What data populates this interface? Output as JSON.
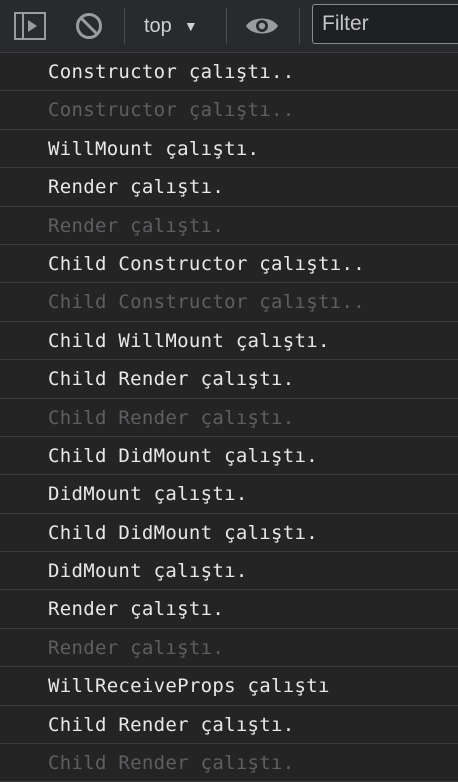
{
  "toolbar": {
    "sidebar_toggle_icon": "sidebar-toggle-icon",
    "clear_icon": "clear-console-icon",
    "context": {
      "selected": "top",
      "caret_icon": "chevron-down-icon"
    },
    "eye_icon": "eye-icon",
    "filter": {
      "placeholder": "Filter",
      "value": ""
    }
  },
  "messages": [
    {
      "text": "Constructor çalıştı..",
      "dim": false
    },
    {
      "text": "Constructor çalıştı..",
      "dim": true
    },
    {
      "text": "WillMount çalıştı.",
      "dim": false
    },
    {
      "text": "Render çalıştı.",
      "dim": false
    },
    {
      "text": "Render çalıştı.",
      "dim": true
    },
    {
      "text": "Child Constructor çalıştı..",
      "dim": false
    },
    {
      "text": "Child Constructor çalıştı..",
      "dim": true
    },
    {
      "text": "Child WillMount çalıştı.",
      "dim": false
    },
    {
      "text": "Child Render çalıştı.",
      "dim": false
    },
    {
      "text": "Child Render çalıştı.",
      "dim": true
    },
    {
      "text": "Child DidMount çalıştı.",
      "dim": false
    },
    {
      "text": "DidMount çalıştı.",
      "dim": false
    },
    {
      "text": "Child DidMount çalıştı.",
      "dim": false
    },
    {
      "text": "DidMount çalıştı.",
      "dim": false
    },
    {
      "text": "Render çalıştı.",
      "dim": false
    },
    {
      "text": "Render çalıştı.",
      "dim": true
    },
    {
      "text": "WillReceiveProps çalıştı",
      "dim": false
    },
    {
      "text": "Child Render çalıştı.",
      "dim": false
    },
    {
      "text": "Child Render çalıştı.",
      "dim": true
    }
  ],
  "colors": {
    "background": "#242424",
    "text": "#e8e8ea",
    "dim_text": "#5e5f62",
    "toolbar": "#292a2d"
  }
}
